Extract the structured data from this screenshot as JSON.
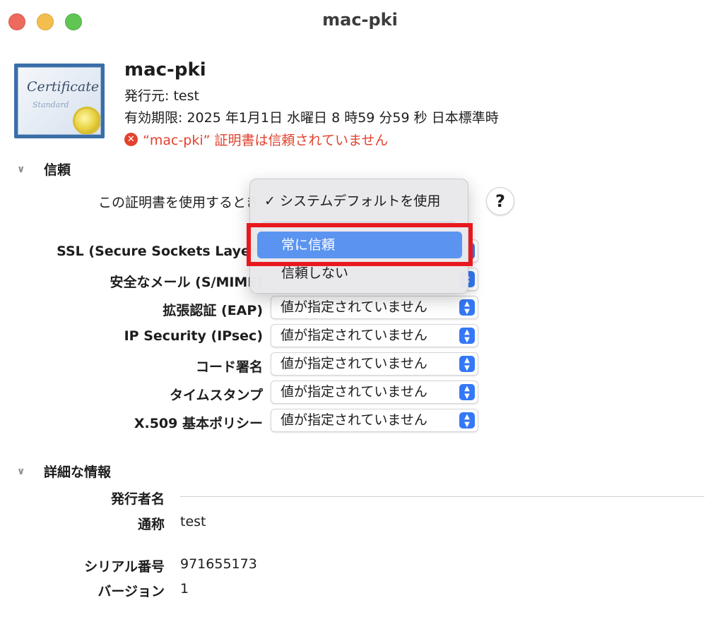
{
  "window": {
    "title": "mac-pki"
  },
  "certificate": {
    "icon_word": "Certificate",
    "icon_sub": "Standard",
    "name": "mac-pki",
    "issuer": "発行元: test",
    "expiry": "有効期限: 2025 年1月1日 水曜日 8 時59 分59 秒 日本標準時",
    "error": "“mac-pki” 証明書は信頼されていません",
    "error_icon": "x-circle-icon"
  },
  "trust": {
    "heading": "信頼",
    "when_using_label": "この証明書を使用するとき",
    "help_label": "?",
    "rows": [
      {
        "label": "SSL (Secure Sockets Layer)",
        "value": ""
      },
      {
        "label": "安全なメール (S/MIME)",
        "value": ""
      },
      {
        "label": "拡張認証 (EAP)",
        "value": "値が指定されていません"
      },
      {
        "label": "IP Security (IPsec)",
        "value": "値が指定されていません"
      },
      {
        "label": "コード署名",
        "value": "値が指定されていません"
      },
      {
        "label": "タイムスタンプ",
        "value": "値が指定されていません"
      },
      {
        "label": "X.509 基本ポリシー",
        "value": "値が指定されていません"
      }
    ],
    "menu": {
      "checkmark": "✓",
      "items": [
        "システムデフォルトを使用",
        "常に信頼",
        "信頼しない"
      ],
      "checked_index": 0,
      "highlighted_index": 1
    }
  },
  "details": {
    "heading": "詳細な情報",
    "issuer_name_label": "発行者名",
    "common_name_label": "通称",
    "common_name_value": "test",
    "serial_label": "シリアル番号",
    "serial_value": "971655173",
    "version_label": "バージョン",
    "version_value": "1"
  },
  "colors": {
    "accent": "#3478f6",
    "error": "#e2422e",
    "highlight_box": "#e8191e",
    "menu_selection": "#5b94f0"
  }
}
